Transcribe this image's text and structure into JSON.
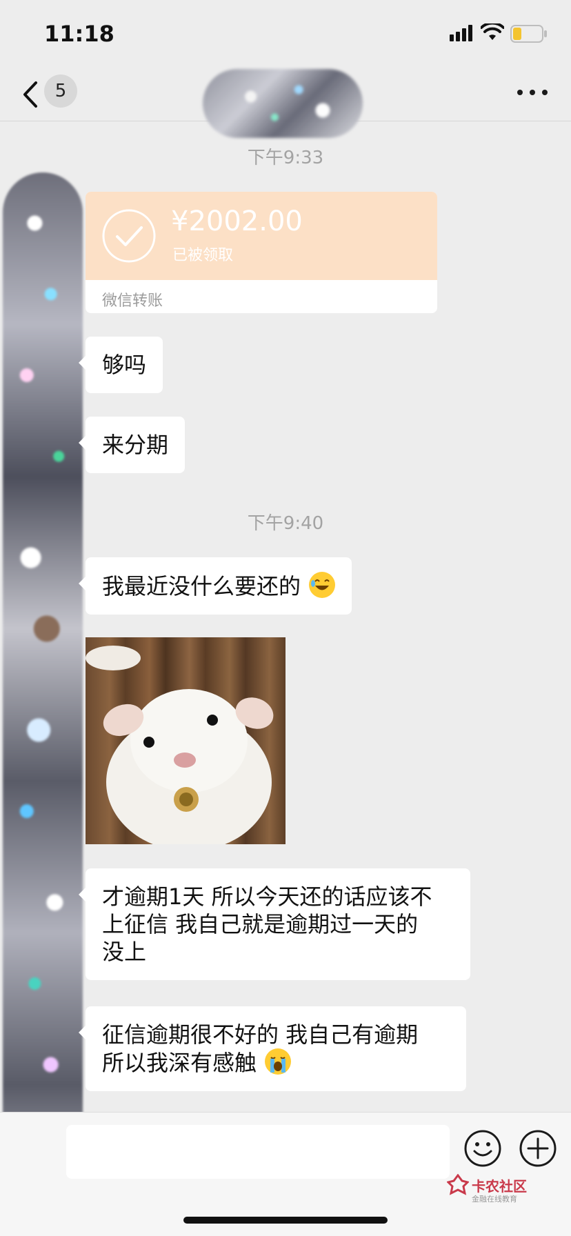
{
  "status_bar": {
    "time": "11:18"
  },
  "nav": {
    "unread_count": "5"
  },
  "messages": {
    "timestamp_1": "下午9:33",
    "transfer": {
      "amount": "¥2002.00",
      "status": "已被领取",
      "label": "微信转账"
    },
    "msg_1": "够吗",
    "msg_2": "来分期",
    "timestamp_2": "下午9:40",
    "msg_3": "我最近没什么要还的",
    "msg_4_line1": "才逾期1天 所以今天还的话应该不",
    "msg_4_line2": "上征信 我自己就是逾期过一天的",
    "msg_4_line3": "没上",
    "msg_5_line1": "征信逾期很不好的 我自己有逾期",
    "msg_5_line2": "所以我深有感触"
  },
  "watermark": {
    "title": "卡农社区",
    "subtitle": "金融在线教育"
  },
  "colors": {
    "transfer_bg": "#fce0c6",
    "chat_bg": "#ededed",
    "bubble_bg": "#ffffff",
    "timestamp": "#a3a3a3"
  },
  "icons": [
    "back-icon",
    "more-icon",
    "check-icon",
    "emoji-icon",
    "plus-icon",
    "signal-icon",
    "wifi-icon",
    "battery-icon",
    "laughing-emoji",
    "crying-emoji"
  ]
}
